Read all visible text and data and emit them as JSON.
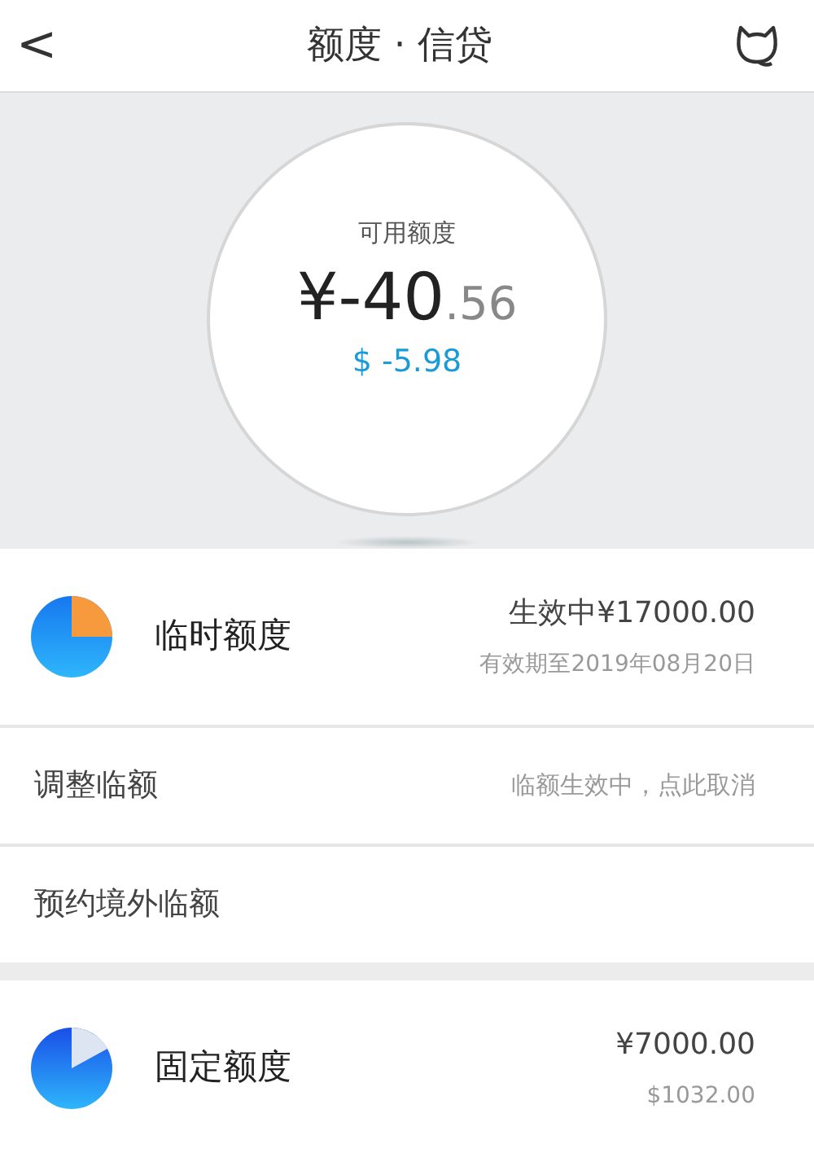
{
  "header": {
    "back": "<",
    "title": "额度 · 信贷"
  },
  "balance": {
    "label": "可用额度",
    "integer": "¥-40",
    "fraction": ".56",
    "usd": "$ -5.98"
  },
  "groups": [
    [
      {
        "kind": "limit",
        "title": "临时额度",
        "amount": "生效中¥17000.00",
        "note": "有效期至2019年08月20日",
        "color": "#f79a3e"
      },
      {
        "kind": "action",
        "label": "调整临额",
        "hint": "临额生效中，点此取消"
      },
      {
        "kind": "action",
        "label": "预约境外临额"
      }
    ],
    [
      {
        "kind": "limit",
        "title": "固定额度",
        "amount": "¥7000.00",
        "note": "$1032.00",
        "color": "#dde4f2"
      }
    ]
  ]
}
